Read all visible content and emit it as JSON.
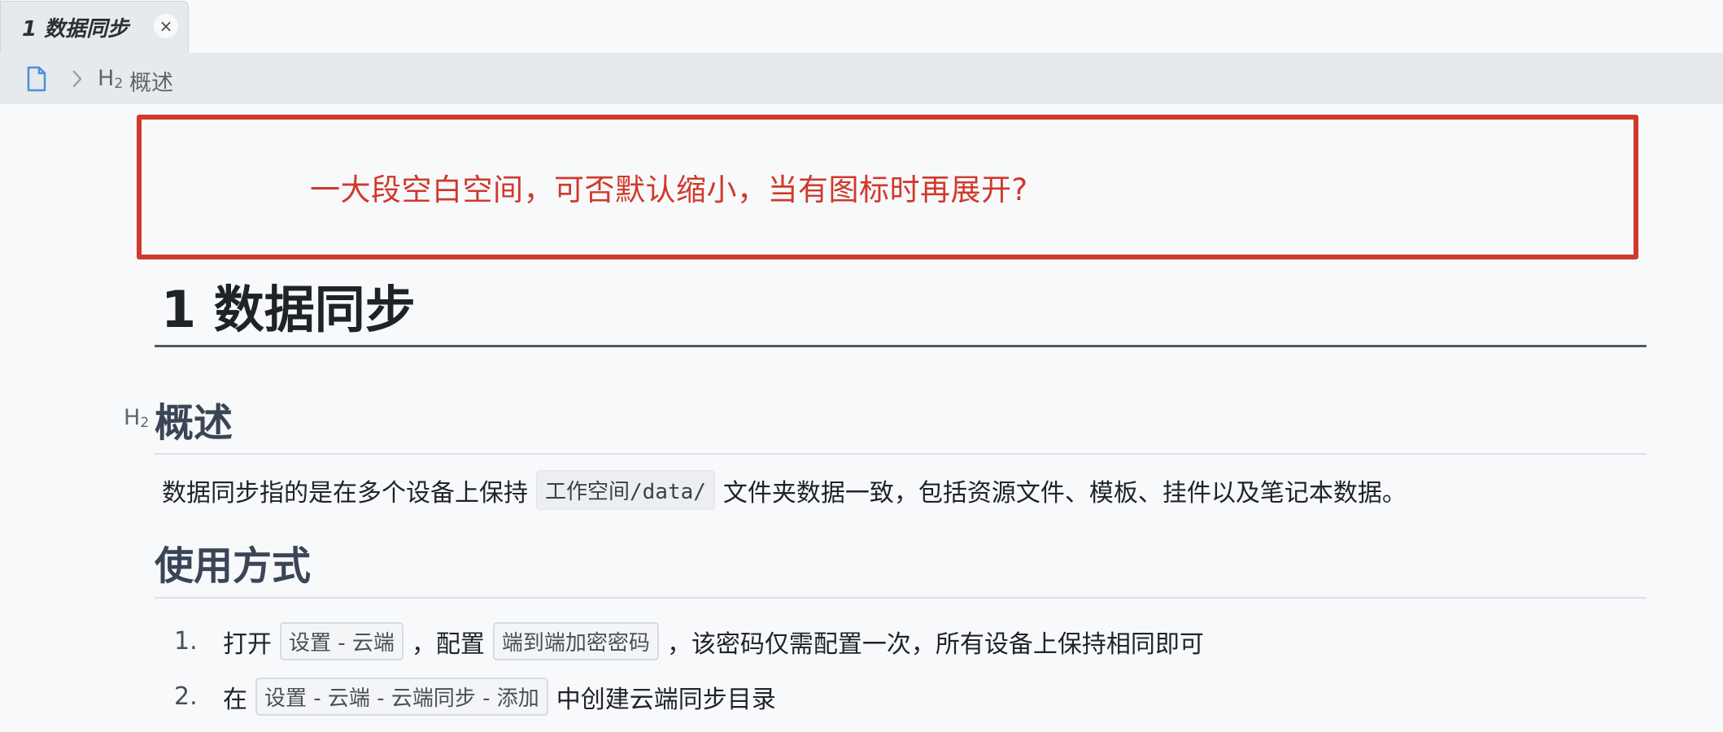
{
  "tab": {
    "title": "1 数据同步",
    "close_glyph": "×"
  },
  "breadcrumb": {
    "heading_level": "H",
    "heading_level_sub": "2",
    "label": "概述"
  },
  "annotation": {
    "text": "一大段空白空间，可否默认缩小，当有图标时再展开?",
    "color": "#d0392b"
  },
  "document": {
    "h1": "1 数据同步",
    "sections": [
      {
        "marker": "H",
        "marker_sub": "2",
        "title": "概述",
        "paragraph": {
          "before": "数据同步指的是在多个设备上保持",
          "code": "工作空间/data/",
          "after": "文件夹数据一致，包括资源文件、模板、挂件以及笔记本数据。"
        }
      },
      {
        "title": "使用方式",
        "list": [
          {
            "num": "1.",
            "t1": "打开",
            "k1": "设置 - 云端",
            "t2": "，配置",
            "k2": "端到端加密密码",
            "t3": "，该密码仅需配置一次，所有设备上保持相同即可"
          },
          {
            "num": "2.",
            "t1": "在",
            "k1": "设置 - 云端 - 云端同步 - 添加",
            "t2": "中创建云端同步目录"
          }
        ]
      }
    ]
  },
  "icons": {
    "breadcrumb_doc": "document-icon",
    "breadcrumb_sep": "chevron-right-icon",
    "tab_close": "close-icon"
  }
}
